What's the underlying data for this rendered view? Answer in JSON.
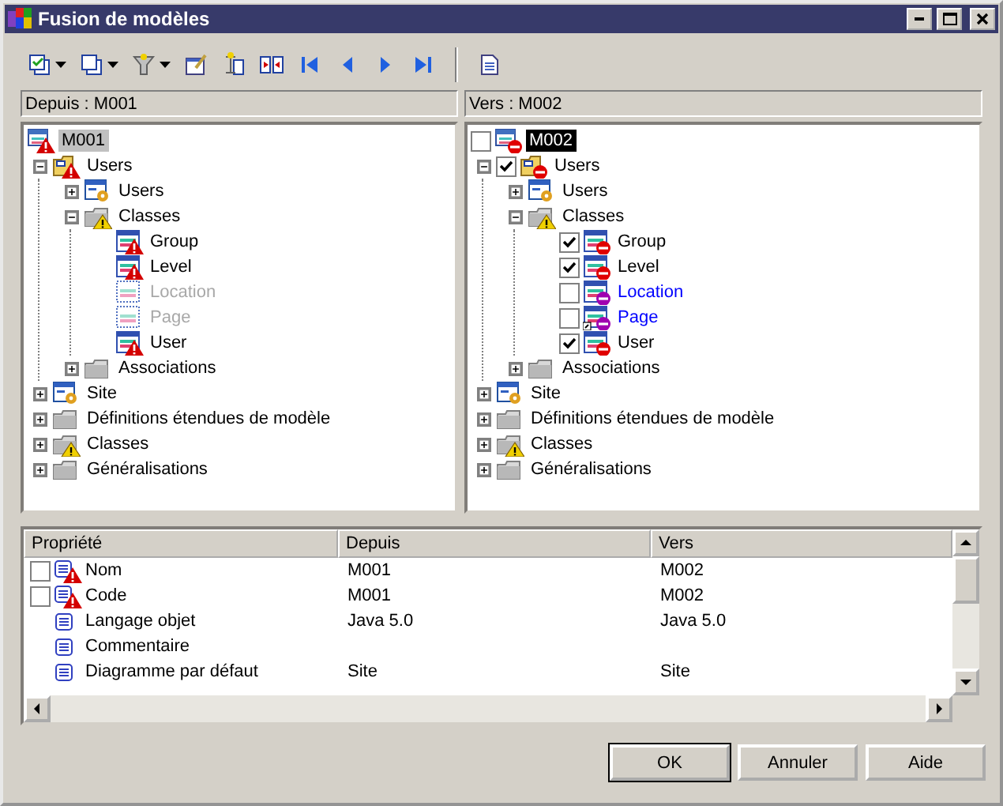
{
  "window": {
    "title": "Fusion de modèles"
  },
  "toolbar": [
    {
      "kind": "check-copies",
      "dropdown": true
    },
    {
      "kind": "copies",
      "dropdown": true
    },
    {
      "kind": "filter",
      "dropdown": true
    },
    {
      "kind": "edit",
      "dropdown": false
    },
    {
      "kind": "compare-sheet",
      "dropdown": false
    },
    {
      "kind": "compare",
      "dropdown": false
    },
    {
      "kind": "first",
      "dropdown": false
    },
    {
      "kind": "prev",
      "dropdown": false
    },
    {
      "kind": "next",
      "dropdown": false
    },
    {
      "kind": "last",
      "dropdown": false
    },
    {
      "kind": "separator"
    },
    {
      "kind": "report",
      "dropdown": false
    }
  ],
  "panes": [
    {
      "header": "Depuis : M001",
      "focused": false,
      "tree": {
        "label": "M001",
        "kind": "model-error",
        "selected": true,
        "children": [
          {
            "label": "Users",
            "kind": "package-error",
            "selected": false,
            "expanded": true,
            "children": [
              {
                "label": "Users",
                "kind": "diagram",
                "selected": false,
                "expanded": false
              },
              {
                "label": "Classes",
                "kind": "folder-warning",
                "selected": false,
                "expanded": true,
                "children": [
                  {
                    "label": "Group",
                    "kind": "class-error",
                    "selected": false
                  },
                  {
                    "label": "Level",
                    "kind": "class-error",
                    "selected": false
                  },
                  {
                    "label": "Location",
                    "kind": "class-missing",
                    "selected": false
                  },
                  {
                    "label": "Page",
                    "kind": "class-missing",
                    "selected": false
                  },
                  {
                    "label": "User",
                    "kind": "class-error",
                    "selected": false
                  }
                ]
              },
              {
                "label": "Associations",
                "kind": "folder",
                "selected": false,
                "expanded": false
              }
            ]
          },
          {
            "label": "Site",
            "kind": "diagram",
            "selected": false,
            "expanded": false
          },
          {
            "label": "Définitions étendues de modèle",
            "kind": "folder",
            "selected": false,
            "expanded": false
          },
          {
            "label": "Classes",
            "kind": "folder-warning",
            "selected": false,
            "expanded": false
          },
          {
            "label": "Généralisations",
            "kind": "folder",
            "selected": false,
            "expanded": false
          }
        ]
      }
    },
    {
      "header": "Vers : M002",
      "focused": true,
      "tree": {
        "label": "M002",
        "kind": "model-delete",
        "checked": false,
        "selected": true,
        "children": [
          {
            "label": "Users",
            "kind": "package-delete",
            "checked": true,
            "selected": false,
            "expanded": true,
            "children": [
              {
                "label": "Users",
                "kind": "diagram",
                "selected": false,
                "expanded": false
              },
              {
                "label": "Classes",
                "kind": "folder-warning",
                "selected": false,
                "expanded": true,
                "children": [
                  {
                    "label": "Group",
                    "kind": "class-delete",
                    "checked": true,
                    "selected": false
                  },
                  {
                    "label": "Level",
                    "kind": "class-delete",
                    "checked": true,
                    "selected": false
                  },
                  {
                    "label": "Location",
                    "kind": "class-add",
                    "checked": false,
                    "selected": false
                  },
                  {
                    "label": "Page",
                    "kind": "shortcut-add",
                    "checked": false,
                    "selected": false
                  },
                  {
                    "label": "User",
                    "kind": "class-delete",
                    "checked": true,
                    "selected": false
                  }
                ]
              },
              {
                "label": "Associations",
                "kind": "folder",
                "selected": false,
                "expanded": false
              }
            ]
          },
          {
            "label": "Site",
            "kind": "diagram",
            "selected": false,
            "expanded": false
          },
          {
            "label": "Définitions étendues de modèle",
            "kind": "folder",
            "selected": false,
            "expanded": false
          },
          {
            "label": "Classes",
            "kind": "folder-warning",
            "selected": false,
            "expanded": false
          },
          {
            "label": "Généralisations",
            "kind": "folder",
            "selected": false,
            "expanded": false
          }
        ]
      }
    }
  ],
  "table": {
    "columns": [
      "Propriété",
      "Depuis",
      "Vers"
    ],
    "rows": [
      {
        "kind": "conflict",
        "checked": false,
        "cells": [
          "Nom",
          "M001",
          "M002"
        ]
      },
      {
        "kind": "conflict",
        "checked": false,
        "cells": [
          "Code",
          "M001",
          "M002"
        ]
      },
      {
        "kind": "plain",
        "cells": [
          "Langage objet",
          "Java 5.0",
          "Java 5.0"
        ]
      },
      {
        "kind": "plain",
        "cells": [
          "Commentaire"
        ]
      },
      {
        "kind": "plain",
        "cells": [
          "Diagramme par défaut",
          "Site",
          "Site"
        ]
      }
    ]
  },
  "buttons": [
    {
      "label": "OK",
      "default": true
    },
    {
      "label": "Annuler",
      "default": false
    },
    {
      "label": "Aide",
      "default": false
    }
  ]
}
